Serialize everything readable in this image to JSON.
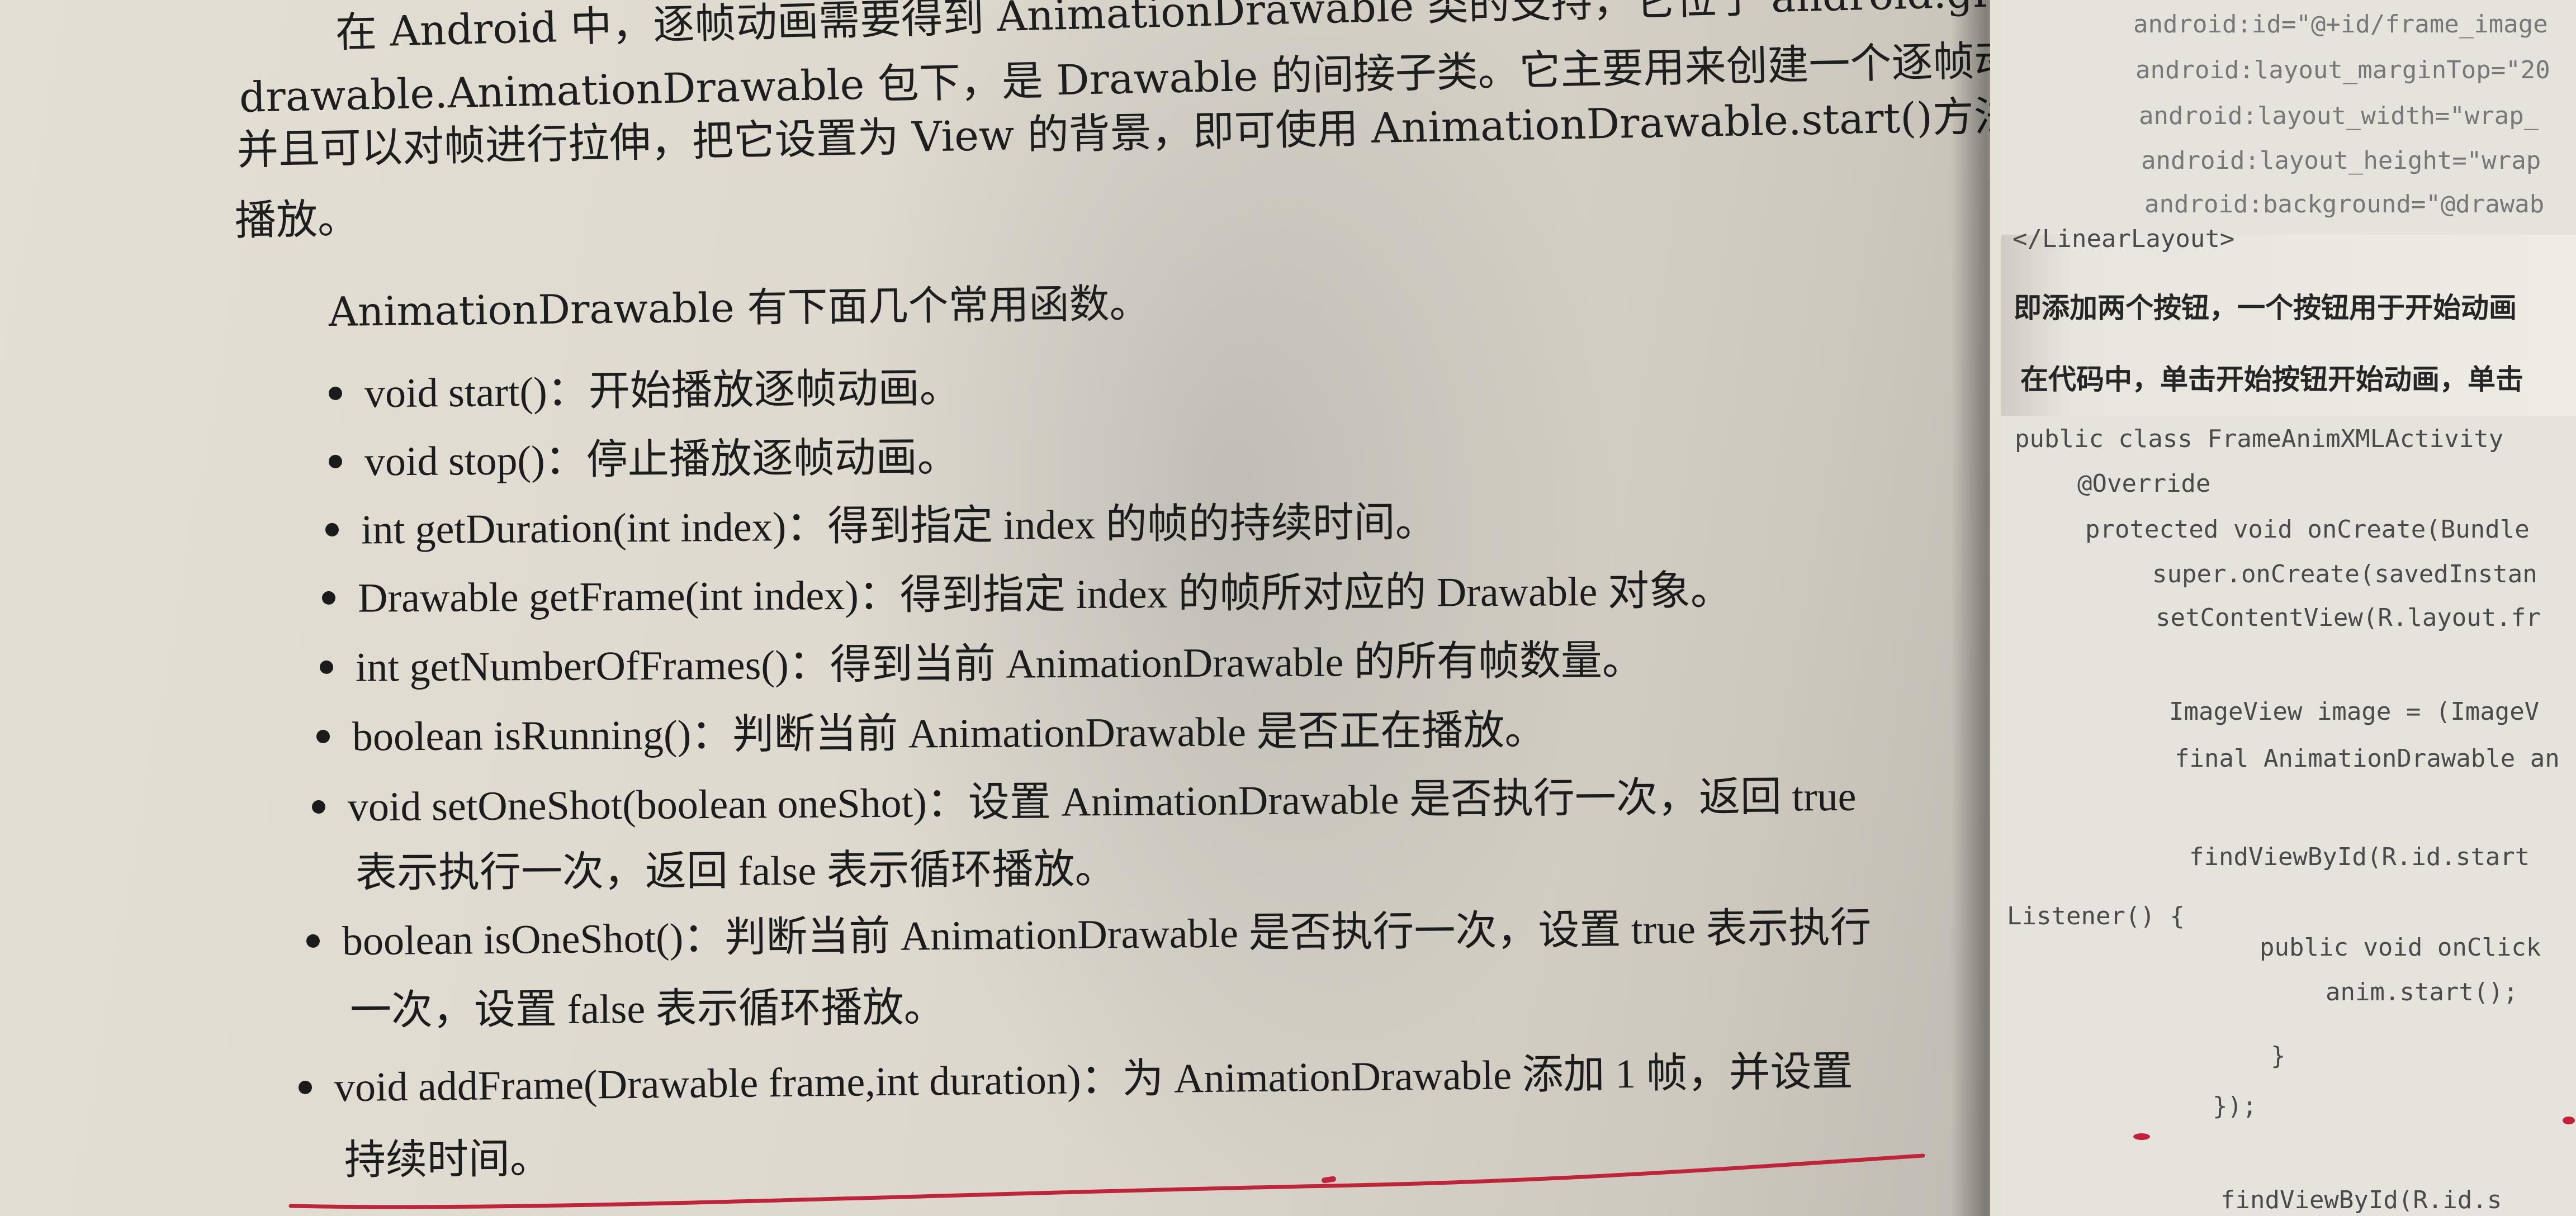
{
  "left_page": {
    "paragraph_lines": [
      "在 Android 中，逐帧动画需要得到 AnimationDrawable 类的支持，它位于 android.graphics.",
      "drawable.AnimationDrawable 包下，是 Drawable 的间接子类。它主要用来创建一个逐帧动画，",
      "并且可以对帧进行拉伸，把它设置为 View 的背景，即可使用 AnimationDrawable.start()方法",
      "播放。"
    ],
    "intro": "AnimationDrawable 有下面几个常用函数。",
    "methods": [
      {
        "lines": [
          "void start()：开始播放逐帧动画。"
        ]
      },
      {
        "lines": [
          "void stop()：停止播放逐帧动画。"
        ]
      },
      {
        "lines": [
          "int getDuration(int index)：得到指定 index 的帧的持续时间。"
        ]
      },
      {
        "lines": [
          "Drawable getFrame(int index)：得到指定 index 的帧所对应的 Drawable 对象。"
        ]
      },
      {
        "lines": [
          "int getNumberOfFrames()：得到当前 AnimationDrawable 的所有帧数量。"
        ]
      },
      {
        "lines": [
          "boolean isRunning()：判断当前 AnimationDrawable 是否正在播放。"
        ]
      },
      {
        "lines": [
          "void setOneShot(boolean oneShot)：设置 AnimationDrawable 是否执行一次，返回 true",
          "表示执行一次，返回 false 表示循环播放。"
        ]
      },
      {
        "lines": [
          "boolean isOneShot()：判断当前 AnimationDrawable 是否执行一次，设置 true 表示执行",
          "一次，设置 false 表示循环播放。"
        ]
      },
      {
        "lines": [
          "void addFrame(Drawable frame,int duration)：为 AnimationDrawable 添加 1 帧，并设置",
          "持续时间。"
        ]
      }
    ]
  },
  "right_page": {
    "top_code": [
      "android:id=\"@+id/frame_image",
      "android:layout_marginTop=\"20",
      "android:layout_width=\"wrap_",
      "android:layout_height=\"wrap",
      "android:background=\"@drawab"
    ],
    "closing_tag": "</LinearLayout>",
    "text_lines": [
      "即添加两个按钮，一个按钮用于开始动画",
      "在代码中，单击开始按钮开始动画，单击"
    ],
    "code_lines": [
      "public class FrameAnimXMLActivity",
      "@Override",
      "protected void onCreate(Bundle",
      "super.onCreate(savedInstan",
      "setContentView(R.layout.fr",
      "ImageView image = (ImageV",
      "final AnimationDrawable an",
      "findViewById(R.id.start",
      "Listener() {",
      "public void onClick",
      "anim.start();",
      "}",
      "});",
      "findViewById(R.id.s"
    ]
  },
  "colors": {
    "paper": "#dcd8ce",
    "ink": "#1c1c1c",
    "pen_red": "#c0243a",
    "code_ink": "#4a4a4a"
  }
}
